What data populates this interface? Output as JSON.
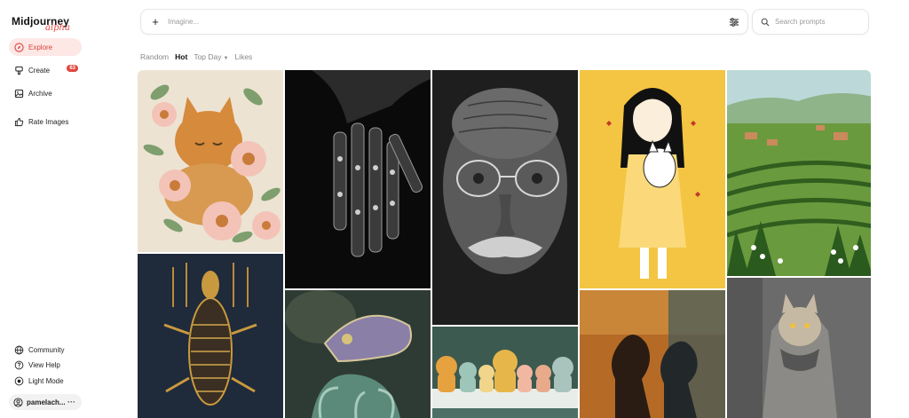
{
  "app": {
    "logo_main": "Midjourney",
    "logo_sub": "alpha",
    "accent": "#e0473f"
  },
  "sidebar": {
    "items": [
      {
        "label": "Explore",
        "icon": "compass-icon",
        "active": true
      },
      {
        "label": "Create",
        "icon": "brush-icon",
        "badge": "63"
      },
      {
        "label": "Archive",
        "icon": "image-icon"
      },
      {
        "label": "Rate Images",
        "icon": "thumbs-up-icon"
      }
    ],
    "bottom": [
      {
        "label": "Community",
        "icon": "globe-icon"
      },
      {
        "label": "View Help",
        "icon": "help-icon"
      },
      {
        "label": "Light Mode",
        "icon": "sun-icon"
      }
    ],
    "user": {
      "name": "pamelach...",
      "more": "···"
    }
  },
  "topbar": {
    "imagine_placeholder": "Imagine...",
    "search_placeholder": "Search prompts"
  },
  "tabs": [
    {
      "label": "Random"
    },
    {
      "label": "Hot",
      "active": true
    },
    {
      "label": "Top Day",
      "dropdown": true
    },
    {
      "label": "Likes"
    }
  ],
  "gallery": {
    "images": [
      {
        "subject": "cat-among-daisies"
      },
      {
        "subject": "robotic-hand"
      },
      {
        "subject": "elderly-man-portrait"
      },
      {
        "subject": "girl-with-cat-illustration"
      },
      {
        "subject": "vineyard-landscape"
      },
      {
        "subject": "ornate-lizard"
      },
      {
        "subject": "jeweled-chameleon"
      },
      {
        "subject": "animal-figurines"
      },
      {
        "subject": "silhouettes-painting"
      },
      {
        "subject": "cat-in-coat"
      }
    ]
  }
}
